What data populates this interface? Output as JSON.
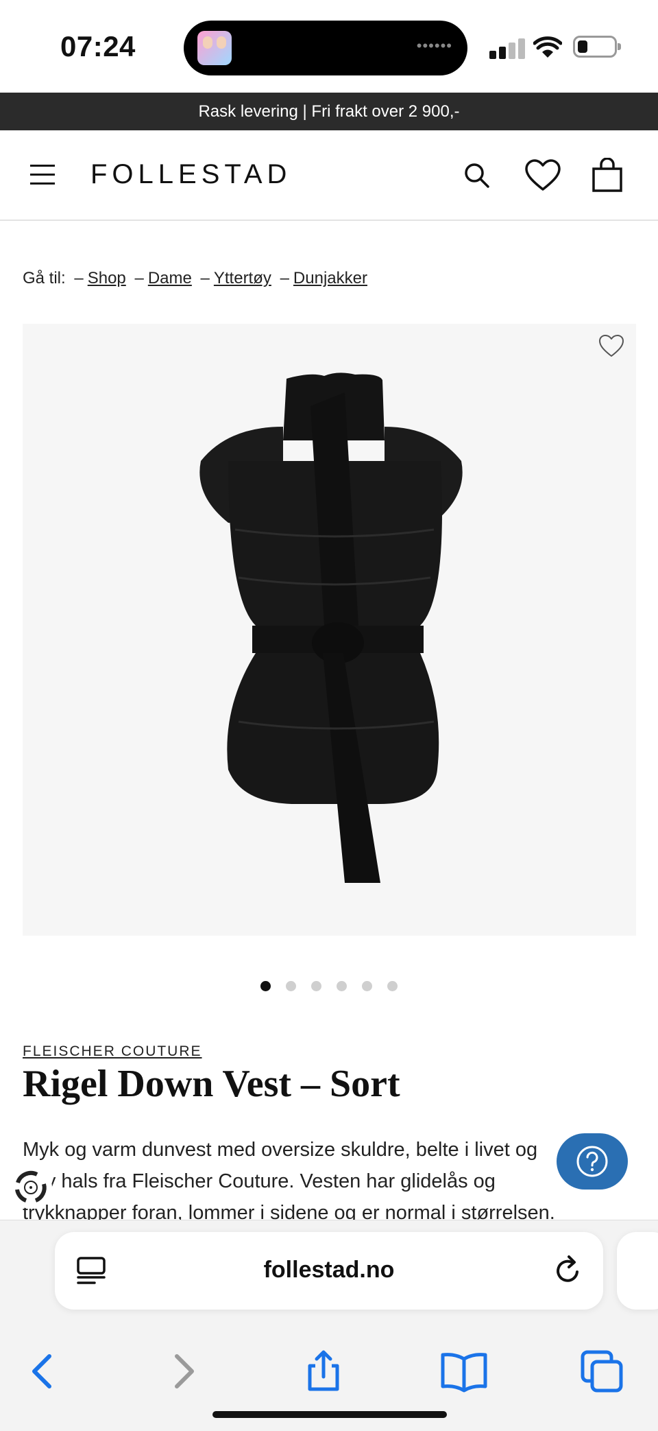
{
  "status_bar": {
    "time": "07:24"
  },
  "promo": {
    "text": "Rask levering | Fri frakt over 2 900,-"
  },
  "header": {
    "logo": "FOLLESTAD"
  },
  "breadcrumb": {
    "prefix": "Gå til:",
    "items": [
      "Shop",
      "Dame",
      "Yttertøy",
      "Dunjakker"
    ]
  },
  "carousel": {
    "total": 6,
    "active_index": 0
  },
  "product": {
    "brand": "FLEISCHER COUTURE",
    "title": "Rigel Down Vest – Sort",
    "description": "Myk og varm dunvest med oversize skuldre, belte i livet og høy hals fra Fleischer Couture. Vesten har glidelås og trykknapper foran, lommer i sidene og er normal i størrelsen."
  },
  "browser": {
    "url": "follestad.no"
  },
  "colors": {
    "promo_bg": "#2b2b2b",
    "help_button": "#2a6fb3",
    "safari_blue": "#1a73e8"
  }
}
